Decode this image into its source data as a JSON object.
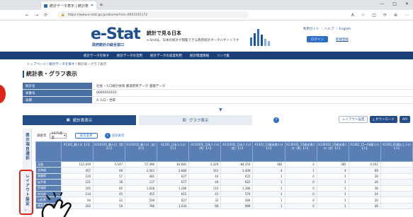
{
  "browser": {
    "tab_title": "統計データ表示 | 統計表・グラフ表示",
    "new_tab": "+",
    "window_controls": [
      "—",
      "□",
      "✕"
    ],
    "url": "https://www.e-stat.go.jp/dbview?sid=0003191172",
    "tool_icons": [
      "A",
      "☆",
      "◫",
      "⟳",
      "⊕",
      "⋯"
    ]
  },
  "header": {
    "logo_main": "e-Stat",
    "logo_sub": "政府統計の総合窓口",
    "slogan": "統計で見る日本",
    "slogan_sub": "e-Statは、日本の統計が閲覧できる政府統計ポータルサイトです",
    "top_links": "利用ガイド ｜ ヘルプ ｜ English",
    "login": "ログイン",
    "register": "新規登録"
  },
  "global_nav": [
    "統計データを探す",
    "統計データの活用",
    "統計データの高度利用",
    "統計関連情報",
    "リンク集"
  ],
  "breadcrumb": {
    "items": [
      "トップページ",
      "統計データを探す"
    ],
    "current": "統計表・グラフ表示",
    "sep": "/"
  },
  "page_title": "統計表・グラフ表示",
  "meta": [
    {
      "k": "統計名",
      "v": "社会・人口統計体系 都道府県データ 基礎データ"
    },
    {
      "k": "表番号",
      "v": "0000010101"
    },
    {
      "k": "表題",
      "v": "A 人口・世帯"
    }
  ],
  "view_tabs": {
    "table": "統計表表示",
    "graph": "グラフ表示",
    "help": "?",
    "layout": "レイアウト設定",
    "download": "ダウンロード",
    "more": "API"
  },
  "side_label": "表示項目選択",
  "side_label2": "レイアウト設定",
  "side_close": "›",
  "toolbar": {
    "label": "調査年",
    "select": "1975年度",
    "display": "表示変更",
    "info": "注記表示"
  },
  "table": {
    "headers": [
      "",
      "A1101_総人口【人】",
      "A110101_総人口（男）【人】",
      "A110102_総人口（女）【人】",
      "A1102_日本人人口【人】",
      "A110201_日本人人口（男）【人】",
      "A110202_日本人人口（女）【人】",
      "A1301_15歳未満人口【人】",
      "A130101_15歳未満人口（男）【人】",
      "A130102_15歳未満人口（女）【人】",
      "A1302_15～64歳人口【人】",
      "A1303_65歳以上人口【人】"
    ],
    "rows": [
      {
        "label": "全国",
        "cells": [
          "111,939",
          "5,547",
          "57,390",
          "83,681",
          "2,329",
          "84,254",
          "382",
          "3",
          "382",
          "4,502"
        ]
      },
      {
        "label": "北海道",
        "cells": [
          "457",
          "69",
          "2,341",
          "2,680",
          "161",
          "2,409",
          "4",
          "1",
          "4",
          "69"
        ]
      },
      {
        "label": "青森県",
        "cells": [
          "120",
          "57",
          "481",
          "627",
          "44",
          "622",
          "1",
          "0",
          "1",
          "28"
        ]
      },
      {
        "label": "岩手県",
        "cells": [
          "121",
          "36",
          "117",
          "677",
          "44",
          "622",
          "1",
          "0",
          "1",
          "26"
        ]
      },
      {
        "label": "宮城県",
        "cells": [
          "245",
          "85",
          "1,028",
          "1,286",
          "110",
          "1,286",
          "1",
          "0",
          "1",
          "38"
        ]
      },
      {
        "label": "秋田県",
        "cells": [
          "114",
          "45",
          "455",
          "615",
          "41",
          "576",
          "1",
          "0",
          "1",
          "24"
        ]
      },
      {
        "label": "山形県",
        "cells": [
          "94",
          "22",
          "509",
          "627",
          "32",
          "580",
          "1",
          "0",
          "1",
          "26"
        ]
      },
      {
        "label": "福島県",
        "cells": [
          "202",
          "59",
          "786",
          "1,034",
          "68",
          "989",
          "1",
          "0",
          "1",
          "48"
        ]
      }
    ]
  },
  "colors": {
    "brand": "#1d4f91",
    "accent_red": "#e1241a",
    "nav": "#1b3f78"
  }
}
